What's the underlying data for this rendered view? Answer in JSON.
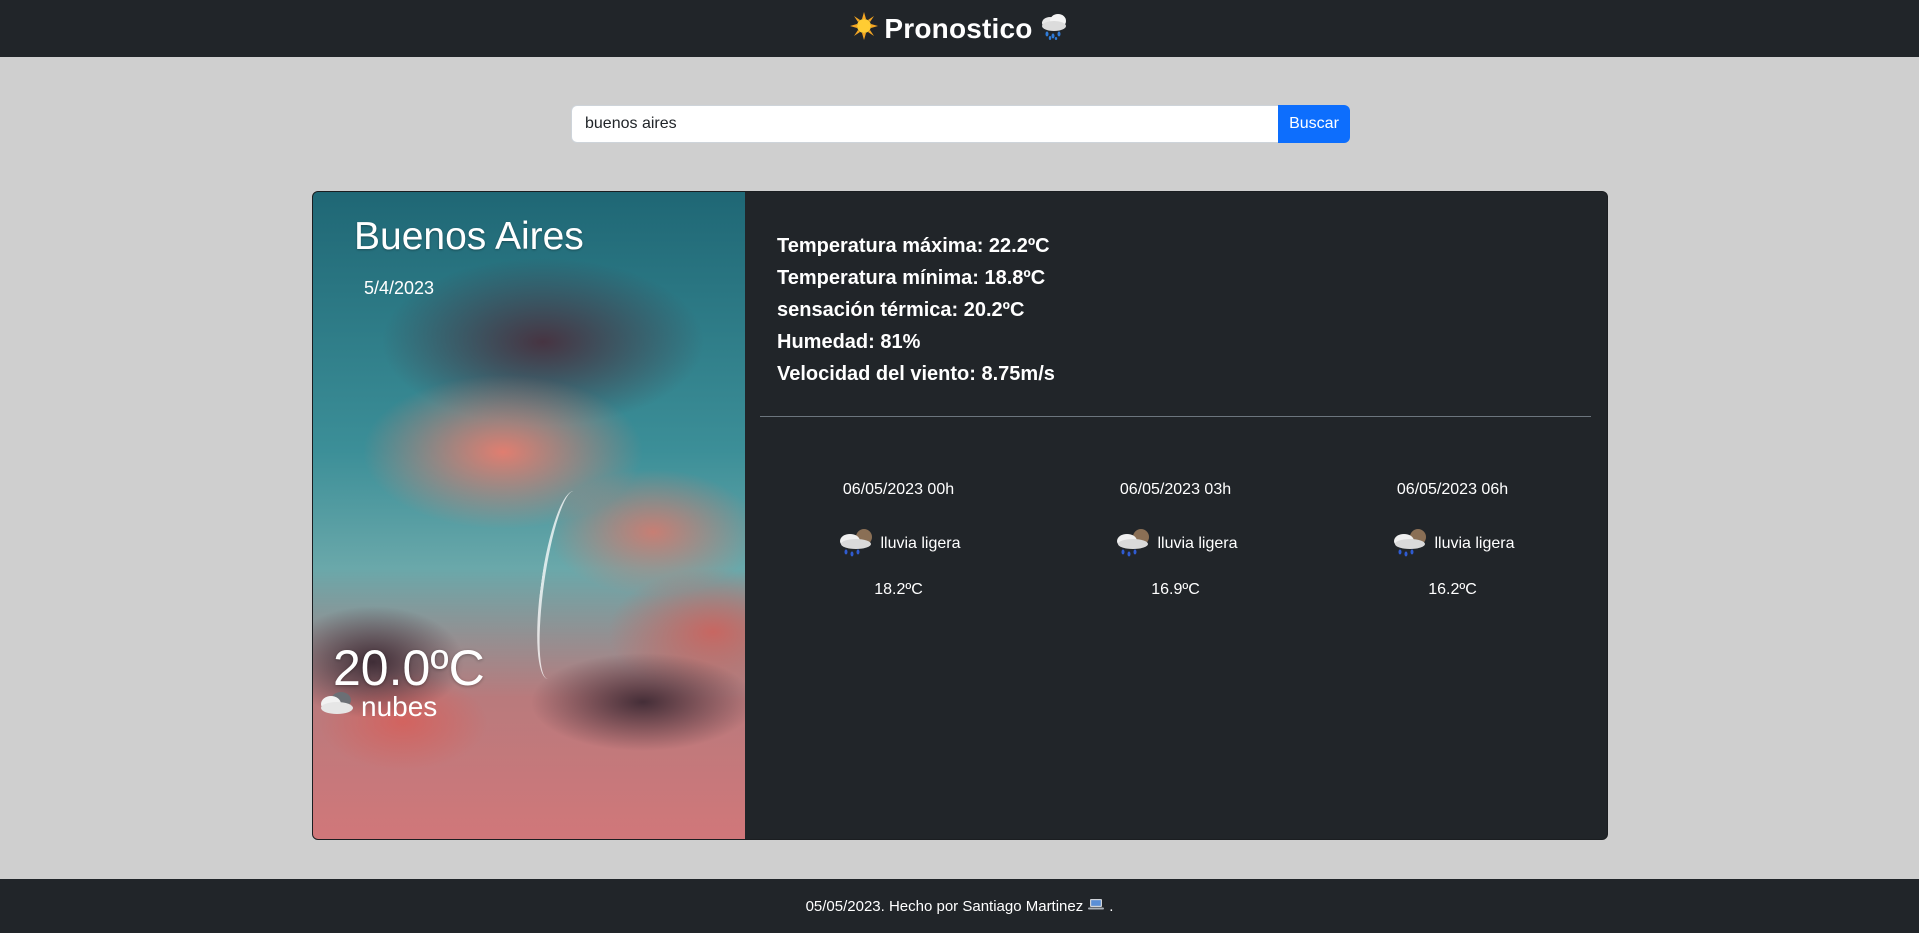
{
  "header": {
    "title": "Pronostico",
    "left_icon": "sun-icon",
    "right_icon": "rain-cloud-icon"
  },
  "search": {
    "value": "buenos aires",
    "button_label": "Buscar"
  },
  "current": {
    "city": "Buenos Aires",
    "date": "5/4/2023",
    "temperature": "20.0ºC",
    "condition": "nubes",
    "condition_icon": "cloud-icon"
  },
  "details": {
    "max": "Temperatura máxima: 22.2ºC",
    "min": "Temperatura mínima: 18.8ºC",
    "feels_like": "sensación térmica: 20.2ºC",
    "humidity": "Humedad: 81%",
    "wind": "Velocidad del viento: 8.75m/s"
  },
  "forecast": [
    {
      "time": "06/05/2023 00h",
      "condition": "lluvia ligera",
      "temp": "18.2ºC",
      "icon": "light-rain-icon"
    },
    {
      "time": "06/05/2023 03h",
      "condition": "lluvia ligera",
      "temp": "16.9ºC",
      "icon": "light-rain-icon"
    },
    {
      "time": "06/05/2023 06h",
      "condition": "lluvia ligera",
      "temp": "16.2ºC",
      "icon": "light-rain-icon"
    }
  ],
  "footer": {
    "text": "05/05/2023. Hecho por Santiago Martinez",
    "end": ".",
    "icon": "laptop-icon"
  },
  "colors": {
    "dark": "#212529",
    "background": "#cfcfcf",
    "primary": "#0d6efd"
  }
}
